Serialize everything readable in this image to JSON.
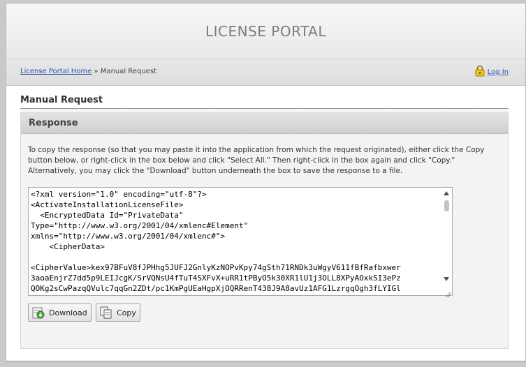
{
  "header": {
    "title": "LICENSE PORTAL"
  },
  "breadcrumb": {
    "home_link": "License Portal Home",
    "separator": "»",
    "current": "Manual Request"
  },
  "login": {
    "label": "Log In"
  },
  "page": {
    "title": "Manual Request"
  },
  "response": {
    "heading": "Response",
    "instructions": "To copy the response (so that you may paste it into the application from which the request originated), either click the Copy button below, or right-click in the box below and click \"Select All.\" Then right-click in the box again and click \"Copy.\" Alternatively, you may click the \"Download\" button underneath the box to save the response to a file.",
    "content": "<?xml version=\"1.0\" encoding=\"utf-8\"?>\n<ActivateInstallationLicenseFile>\n  <EncryptedData Id=\"PrivateData\"\nType=\"http://www.w3.org/2001/04/xmlenc#Element\"\nxmlns=\"http://www.w3.org/2001/04/xmlenc#\">\n    <CipherData>\n\n<CipherValue>kex97BFuV8fJPHhg5JUFJ2GnlyKzNOPvKpy74gSth71RNDk3uWgyV611fBfRafbxwer\n3aoaEnjrZ7dd5p9LEIJcgK/SrVQNsU4fTuT4SXFvX+uRR1tPByO5k30XR1lU1j3OLL8XPyAOxkSI3ePz\nQOKg2sCwPazqQVulc7qqGn2ZDt/pc1KmPgUEaHgpXjOQRRenT438J9A8avUz1AFG1LzrgqOgh3fLYIGl"
  },
  "buttons": {
    "download": "Download",
    "copy": "Copy"
  },
  "colors": {
    "link": "#2a52b0",
    "header_text": "#7d7d7d"
  }
}
